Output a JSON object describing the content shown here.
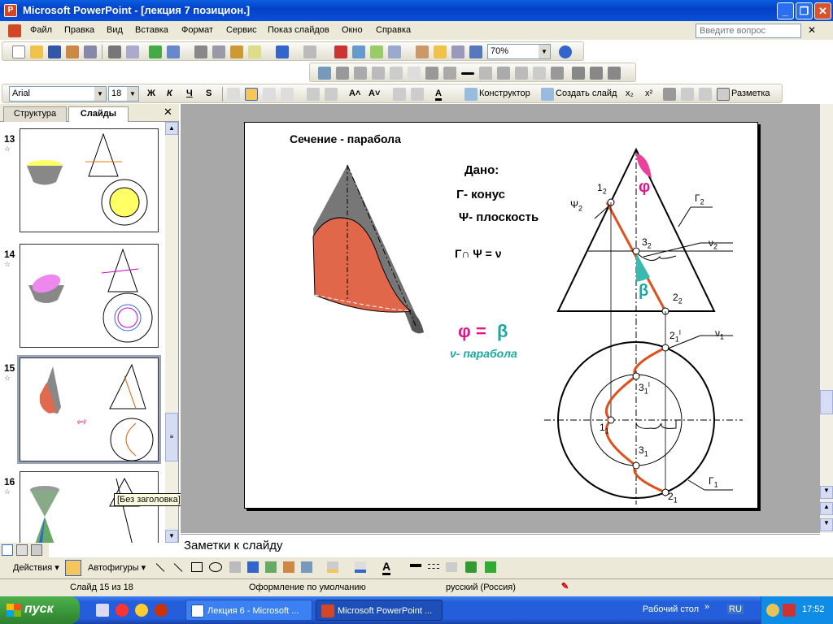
{
  "window": {
    "title": "Microsoft PowerPoint - [лекция 7 позицион.]"
  },
  "menu": {
    "items": [
      "Файл",
      "Правка",
      "Вид",
      "Вставка",
      "Формат",
      "Сервис",
      "Показ слайдов",
      "Окно",
      "Справка"
    ],
    "help_placeholder": "Введите вопрос"
  },
  "toolbar": {
    "zoom": "70%",
    "font_name": "Arial",
    "font_size": "18",
    "designer_label": "Конструктор",
    "new_slide_label": "Создать слайд",
    "layout_label": "Разметка"
  },
  "left_panel": {
    "tabs": [
      "Структура",
      "Слайды"
    ],
    "slides": [
      {
        "number": "13"
      },
      {
        "number": "14"
      },
      {
        "number": "15",
        "selected": true
      },
      {
        "number": "16"
      }
    ],
    "tooltip": "[Без заголовка]"
  },
  "slide": {
    "title": "Сечение  - парабола",
    "given": "Дано:",
    "gamma_cone": "Γ- конус",
    "psi_plane": "Ψ- плоскость",
    "intersection": "Γ∩ Ψ = ν",
    "phi_eq": "φ =",
    "beta": "β",
    "parabola": "ν- парабола",
    "labels": {
      "one2": "1",
      "sub2": "2",
      "psi2": "Ψ",
      "gamma2": "Γ",
      "three2": "3",
      "nu2": "ν",
      "two2": "2",
      "phi": "φ",
      "beta_small": "β",
      "two1p": "2",
      "nu1": "ν",
      "three1p": "3",
      "one1": "1",
      "three1": "3",
      "two1": "2",
      "gamma1": "Γ",
      "sub1": "1",
      "prime": "I"
    }
  },
  "notes": {
    "placeholder": "Заметки к слайду"
  },
  "drawing_toolbar": {
    "actions": "Действия",
    "autoshapes": "Автофигуры"
  },
  "status": {
    "slide_of": "Слайд 15 из 18",
    "design": "Оформление по умолчанию",
    "language": "русский (Россия)"
  },
  "taskbar": {
    "start": "пуск",
    "tasks": [
      "Лекция 6 - Microsoft ...",
      "Microsoft PowerPoint ..."
    ],
    "desktop": "Рабочий стол",
    "lang": "RU",
    "time": "17:52"
  }
}
